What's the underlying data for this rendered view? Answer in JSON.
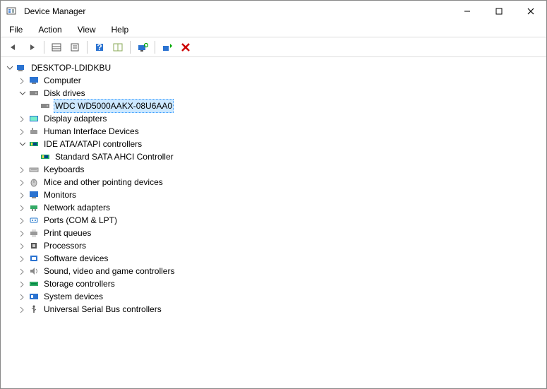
{
  "window": {
    "title": "Device Manager"
  },
  "menu": {
    "file": "File",
    "action": "Action",
    "view": "View",
    "help": "Help"
  },
  "tree": {
    "root": "DESKTOP-LDIDKBU",
    "computer": "Computer",
    "disk_drives": "Disk drives",
    "wdc_drive": "WDC WD5000AAKX-08U6AA0",
    "display_adapters": "Display adapters",
    "hid": "Human Interface Devices",
    "ide": "IDE ATA/ATAPI controllers",
    "sata_ahci": "Standard SATA AHCI Controller",
    "keyboards": "Keyboards",
    "mice": "Mice and other pointing devices",
    "monitors": "Monitors",
    "network": "Network adapters",
    "ports": "Ports (COM & LPT)",
    "print_queues": "Print queues",
    "processors": "Processors",
    "software_devices": "Software devices",
    "sound": "Sound, video and game controllers",
    "storage_controllers": "Storage controllers",
    "system_devices": "System devices",
    "usb": "Universal Serial Bus controllers"
  }
}
